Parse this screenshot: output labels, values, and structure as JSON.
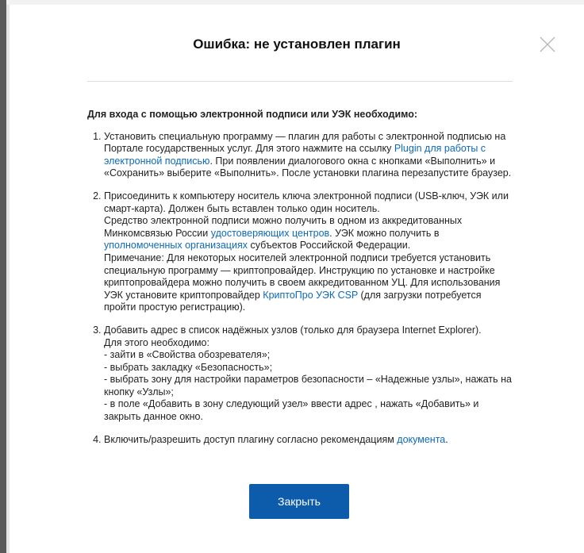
{
  "dialog": {
    "title": "Ошибка: не установлен плагин",
    "intro": "Для входа с помощью электронной подписи или УЭК необходимо:",
    "close_button_label": "Закрыть"
  },
  "steps": {
    "s1": {
      "t1": "Установить специальную программу — плагин для работы с электронной подписью на Портале государственных услуг. Для этого нажмите на ссылку ",
      "link": "Plugin для работы с электронной подписью",
      "t2": ". При появлении диалогового окна с кнопками «Выполнить» и «Сохранить» выберите «Выполнить». После установки плагина перезапустите браузер."
    },
    "s2": {
      "t1": "Присоединить к компьютеру носитель ключа электронной подписи (USB-ключ, УЭК или смарт-карта). Должен быть вставлен только один носитель.",
      "t2": "Средство электронной подписи можно получить в одном из аккредитованных Минкомсвязью России ",
      "link1": "удостоверяющих центров",
      "t3": ". УЭК можно получить в ",
      "link2": "уполномоченных организациях",
      "t4": " субъектов Российской Федерации.",
      "t5": "Примечание: Для некоторых носителей электронной подписи требуется установить специальную программу — криптопровайдер. Инструкцию по установке и настройке криптопровайдера можно получить в своем аккредитованном УЦ. Для использования УЭК установите криптопровайдер ",
      "link3": "КриптоПро УЭК CSP",
      "t6": " (для загрузки потребуется пройти простую регистрацию)."
    },
    "s3": {
      "line1": "Добавить адрес в список надёжных узлов (только для браузера Internet Explorer).",
      "line2": "Для этого необходимо:",
      "line3": "- зайти в «Свойства обозревателя»;",
      "line4": "- выбрать закладку «Безопасность»;",
      "line5": "- выбрать зону для настройки параметров безопасности – «Надежные узлы», нажать на кнопку «Узлы»;",
      "line6": "- в поле «Добавить в зону следующий узел» ввести адрес , нажать «Добавить» и закрыть данное окно."
    },
    "s4": {
      "t1": "Включить/разрешить доступ плагину согласно рекомендациям ",
      "link": "документа",
      "t2": "."
    }
  },
  "icons": {
    "close": "close-icon"
  },
  "colors": {
    "link": "#0d6ab8",
    "button": "#0d5cab",
    "frame": "#5a5a5a"
  }
}
